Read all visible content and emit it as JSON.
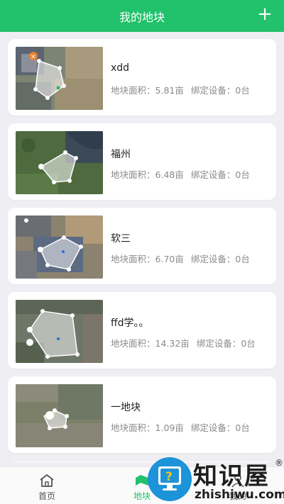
{
  "header": {
    "title": "我的地块",
    "add_icon": "plus-icon"
  },
  "fields": [
    {
      "name": "xdd",
      "area_label": "地块面积：",
      "area_value": "5.81亩",
      "device_label": "绑定设备：",
      "device_value": "0台"
    },
    {
      "name": "福州",
      "area_label": "地块面积：",
      "area_value": "6.48亩",
      "device_label": "绑定设备：",
      "device_value": "0台"
    },
    {
      "name": "软三",
      "area_label": "地块面积：",
      "area_value": "6.70亩",
      "device_label": "绑定设备：",
      "device_value": "0台"
    },
    {
      "name": "ffd学。。",
      "area_label": "地块面积：",
      "area_value": "14.32亩",
      "device_label": "绑定设备：",
      "device_value": "0台"
    },
    {
      "name": "一地块",
      "area_label": "地块面积：",
      "area_value": "1.09亩",
      "device_label": "绑定设备：",
      "device_value": "0台"
    }
  ],
  "tabs": [
    {
      "label": "首页",
      "icon": "home-icon",
      "active": false
    },
    {
      "label": "地块",
      "icon": "plot-icon",
      "active": true
    },
    {
      "label": "我的",
      "icon": "user-icon",
      "active": false
    }
  ],
  "watermark": {
    "text": "知识屋",
    "sub": "zhishiwu.com",
    "reg": "®"
  },
  "colors": {
    "brand": "#22c16b",
    "background": "#eeeef3",
    "watermark_blue": "#1d93d9"
  }
}
